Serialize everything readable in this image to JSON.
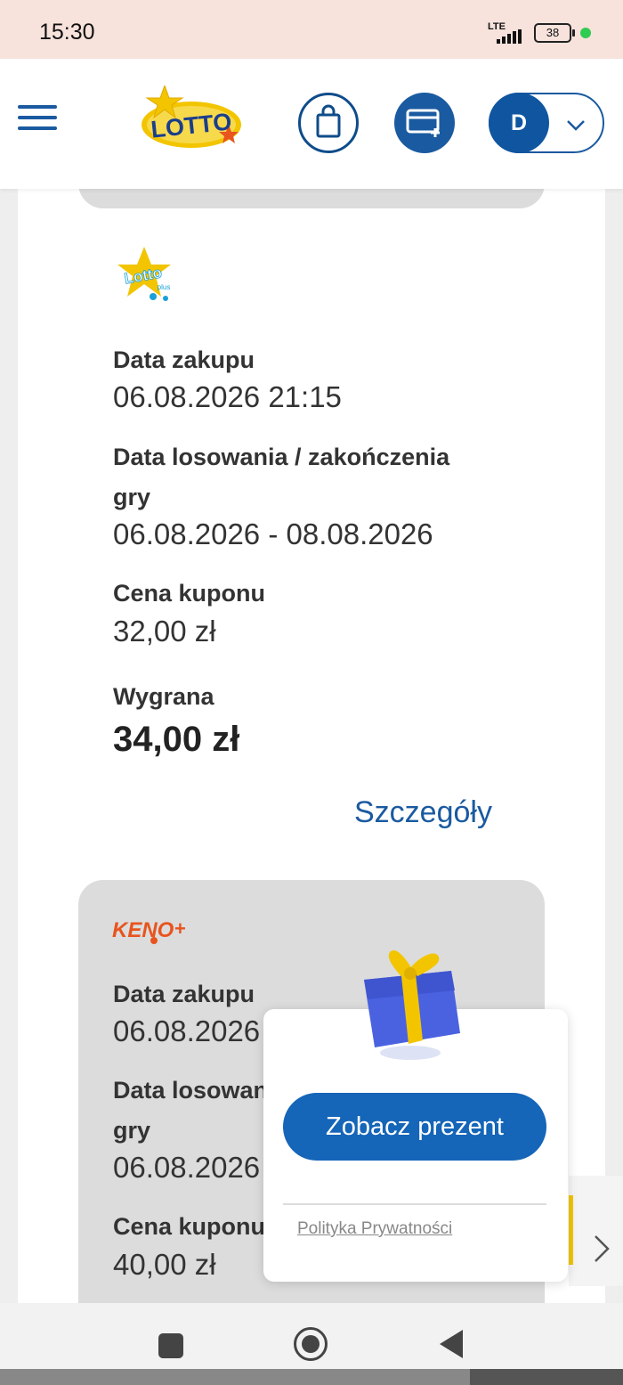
{
  "status_bar": {
    "time": "15:30",
    "network": "LTE",
    "battery": "38"
  },
  "header": {
    "logo_text": "LOTTO",
    "avatar_letter": "D"
  },
  "tickets": [
    {
      "game_logo_text": "Lotto",
      "game_logo_sub": "plus",
      "purchase_label": "Data zakupu",
      "purchase_value": "06.08.2026 21:15",
      "draw_label_line1": "Data losowania / zakończenia",
      "draw_label_line2": "gry",
      "draw_value": "06.08.2026 - 08.08.2026",
      "price_label": "Cena kuponu",
      "price_value": "32,00 zł",
      "win_label": "Wygrana",
      "win_value": "34,00 zł",
      "details_link": "Szczegóły"
    },
    {
      "game_logo_text": "KENO",
      "purchase_label": "Data zakupu",
      "purchase_value": "06.08.2026",
      "draw_label_line1": "Data losowan",
      "draw_label_line2": "gry",
      "draw_value": "06.08.2026",
      "price_label": "Cena kuponu",
      "price_value": "40,00 zł"
    }
  ],
  "popup": {
    "cta_label": "Zobacz prezent",
    "privacy_link": "Polityka Prywatności"
  },
  "colors": {
    "brand_blue": "#1a5aa0",
    "cta_blue": "#1565b8",
    "lotto_yellow": "#f2c500",
    "keno_orange": "#e8541e"
  }
}
